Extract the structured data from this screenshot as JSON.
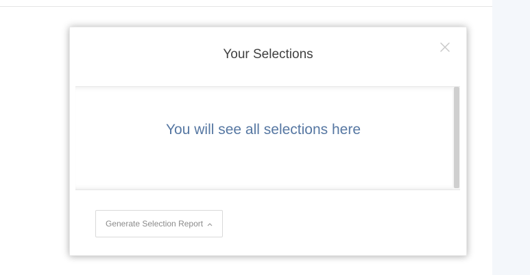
{
  "modal": {
    "title": "Your Selections",
    "close_icon": "close-icon",
    "empty_message": "You will see all selections here",
    "report_button_label": "Generate Selection Report",
    "report_button_icon": "chevron-up-icon"
  },
  "colors": {
    "title_text": "#3f3f3f",
    "empty_message_text": "#5677a2",
    "button_text": "#8a8a8a",
    "right_panel_background": "#f4f7fb",
    "close_icon": "#c8c8c8"
  }
}
